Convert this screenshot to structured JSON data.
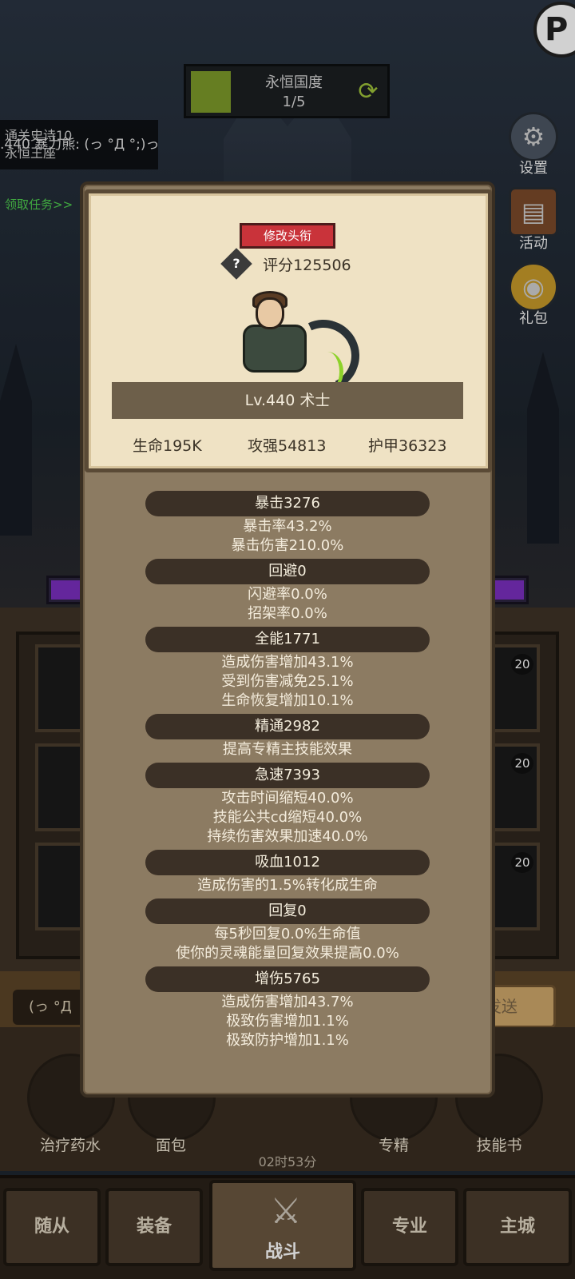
{
  "hud": {
    "stage_name": "永恒国度",
    "stage_progress": "1/5",
    "info_line1": "通关史诗10",
    "info_line2": "永恒王座",
    "info_overlay": ".440 暴力熊: (っ °Д °;)っ",
    "task_link": "领取任务>>",
    "side_buttons": [
      "设置",
      "活动",
      "礼包"
    ]
  },
  "modal": {
    "title_button": "修改头衔",
    "score": "评分125506",
    "level_line": "Lv.440 术士",
    "basic_stats": [
      "生命195K",
      "攻强54813",
      "护甲36323"
    ],
    "sections": [
      {
        "head": "暴击3276",
        "lines": [
          "暴击率43.2%",
          "暴击伤害210.0%"
        ]
      },
      {
        "head": "回避0",
        "lines": [
          "闪避率0.0%",
          "招架率0.0%"
        ]
      },
      {
        "head": "全能1771",
        "lines": [
          "造成伤害增加43.1%",
          "受到伤害减免25.1%",
          "生命恢复增加10.1%"
        ]
      },
      {
        "head": "精通2982",
        "lines": [
          "提高专精主技能效果"
        ]
      },
      {
        "head": "急速7393",
        "lines": [
          "攻击时间缩短40.0%",
          "技能公共cd缩短40.0%",
          "持续伤害效果加速40.0%"
        ]
      },
      {
        "head": "吸血1012",
        "lines": [
          "造成伤害的1.5%转化成生命"
        ]
      },
      {
        "head": "回复0",
        "lines": [
          "每5秒回复0.0%生命值",
          "使你的灵魂能量回复效果提高0.0%"
        ]
      },
      {
        "head": "增伤5765",
        "lines": [
          "造成伤害增加43.7%",
          "极致伤害增加1.1%",
          "极致防护增加1.1%"
        ]
      }
    ]
  },
  "gear": {
    "slot_level": "20"
  },
  "chat": {
    "input_text": "(っ °Д",
    "send_label": "发送"
  },
  "items": {
    "labels": [
      "治疗药水",
      "面包",
      "专精",
      "技能书"
    ],
    "timer": "02时53分"
  },
  "nav": {
    "tabs": [
      "随从",
      "装备",
      "战斗",
      "专业",
      "主城"
    ]
  },
  "colors": {
    "accent_red": "#c9333a",
    "stage_green": "#7d9a2a",
    "task_green": "#4fcf4f",
    "bar_purple": "#7a2fbf"
  }
}
